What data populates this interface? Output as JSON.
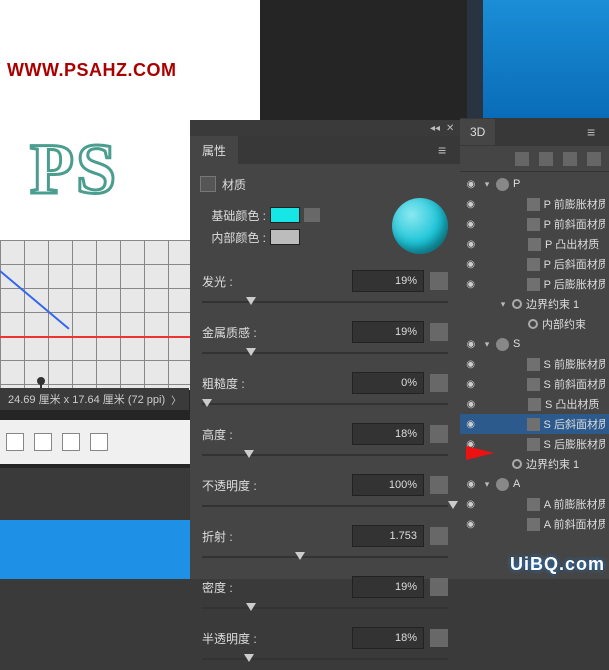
{
  "watermark_url": "WWW.PSAHZ.COM",
  "canvas": {
    "ps_text": "PS",
    "info": "24.69 厘米 x 17.64 厘米 (72 ppi)",
    "info_arrow": "〉"
  },
  "properties": {
    "collapse_icon": "◂◂",
    "close_icon": "✕",
    "tab": "属性",
    "material_label": "材质",
    "base_color_label": "基础颜色 :",
    "base_color": "#16e6e6",
    "inner_color_label": "内部颜色 :",
    "inner_color": "#bcbcbc",
    "sliders": [
      {
        "label": "发光 :",
        "value": "19%",
        "pos": 18
      },
      {
        "label": "金属质感 :",
        "value": "19%",
        "pos": 18
      },
      {
        "label": "粗糙度 :",
        "value": "0%",
        "pos": 0
      },
      {
        "label": "高度 :",
        "value": "18%",
        "pos": 17
      },
      {
        "label": "不透明度 :",
        "value": "100%",
        "pos": 100
      },
      {
        "label": "折射 :",
        "value": "1.753",
        "pos": 38
      },
      {
        "label": "密度 :",
        "value": "19%",
        "pos": 18
      },
      {
        "label": "半透明度 :",
        "value": "18%",
        "pos": 17
      }
    ]
  },
  "panel3d": {
    "tab": "3D",
    "tree": [
      {
        "eye": true,
        "ind": 0,
        "tw": "▾",
        "icon": "sphere",
        "label": "P"
      },
      {
        "eye": true,
        "ind": 2,
        "icon": "nic",
        "label": "P 前膨胀材质"
      },
      {
        "eye": true,
        "ind": 2,
        "icon": "nic",
        "label": "P 前斜面材质"
      },
      {
        "eye": true,
        "ind": 2,
        "icon": "nic",
        "label": "P 凸出材质"
      },
      {
        "eye": true,
        "ind": 2,
        "icon": "nic",
        "label": "P 后斜面材质"
      },
      {
        "eye": true,
        "ind": 2,
        "icon": "nic",
        "label": "P 后膨胀材质"
      },
      {
        "eye": false,
        "ind": 1,
        "tw": "▾",
        "icon": "ring",
        "label": "边界约束  1"
      },
      {
        "eye": false,
        "ind": 2,
        "icon": "ring",
        "label": "内部约束"
      },
      {
        "eye": true,
        "ind": 0,
        "tw": "▾",
        "icon": "sphere",
        "label": "S"
      },
      {
        "eye": true,
        "ind": 2,
        "icon": "nic",
        "label": "S 前膨胀材质"
      },
      {
        "eye": true,
        "ind": 2,
        "icon": "nic",
        "label": "S 前斜面材质"
      },
      {
        "eye": true,
        "ind": 2,
        "icon": "nic",
        "label": "S 凸出材质"
      },
      {
        "eye": true,
        "ind": 2,
        "icon": "nic",
        "label": "S 后斜面材质",
        "sel": true
      },
      {
        "eye": true,
        "ind": 2,
        "icon": "nic",
        "label": "S 后膨胀材质"
      },
      {
        "eye": false,
        "ind": 1,
        "icon": "ring",
        "label": "边界约束  1"
      },
      {
        "eye": true,
        "ind": 0,
        "tw": "▾",
        "icon": "sphere",
        "label": "A"
      },
      {
        "eye": true,
        "ind": 2,
        "icon": "nic",
        "label": "A 前膨胀材质"
      },
      {
        "eye": true,
        "ind": 2,
        "icon": "nic",
        "label": "A 前斜面材质"
      }
    ]
  },
  "uibq": "UiBQ.com"
}
